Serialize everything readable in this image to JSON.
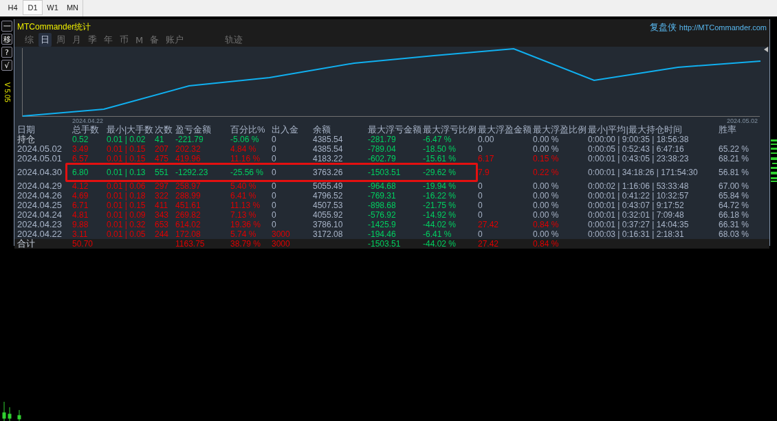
{
  "timeframes": [
    {
      "label": "H4",
      "selected": false
    },
    {
      "label": "D1",
      "selected": true
    },
    {
      "label": "W1",
      "selected": false
    },
    {
      "label": "MN",
      "selected": false
    }
  ],
  "toolbar": {
    "buttons": [
      "一",
      "移",
      "?",
      "√"
    ],
    "version": "V 5.05"
  },
  "panel": {
    "title": "MTCommander统计",
    "brand": "复盘侠",
    "link": "http://MTCommander.com",
    "tabs": [
      {
        "label": "综",
        "selected": false
      },
      {
        "label": "日",
        "selected": true
      },
      {
        "label": "周",
        "selected": false
      },
      {
        "label": "月",
        "selected": false
      },
      {
        "label": "季",
        "selected": false
      },
      {
        "label": "年",
        "selected": false
      },
      {
        "label": "币",
        "selected": false
      },
      {
        "label": "M",
        "selected": false
      },
      {
        "label": "备",
        "selected": false
      },
      {
        "label": "账户",
        "selected": false
      },
      {
        "label": "轨迹",
        "selected": false
      }
    ],
    "chart": {
      "start_label": "2024.04.22",
      "end_label": "2024.05.02"
    },
    "table": {
      "columns": [
        "日期",
        "总手数",
        "最小|大手数",
        "次数",
        "盈亏金额",
        "百分比%",
        "出入金",
        "余额",
        "最大浮亏金额",
        "最大浮亏比例",
        "最大浮盈金额",
        "最大浮盈比例",
        "最小|平均|最大持仓时间",
        "胜率"
      ],
      "rows": [
        {
          "highlighted": false,
          "cells": [
            {
              "text": "持仓",
              "color": "#c8d0dc"
            },
            {
              "text": "0.52",
              "color": "#00d060"
            },
            {
              "text": "0.01 | 0.02",
              "color": "#00d060"
            },
            {
              "text": "41",
              "color": "#00d060"
            },
            {
              "text": "-221.79",
              "color": "#00d060"
            },
            {
              "text": "-5.06 %",
              "color": "#00d060"
            },
            {
              "text": "0",
              "color": "#a8b4c8"
            },
            {
              "text": "4385.54",
              "color": "#a8b4c8"
            },
            {
              "text": "-281.79",
              "color": "#00d060"
            },
            {
              "text": "-6.47 %",
              "color": "#00d060"
            },
            {
              "text": "0.00",
              "color": "#a8b4c8"
            },
            {
              "text": "0.00 %",
              "color": "#a8b4c8"
            },
            {
              "text": "0:00:00 | 9:00:35 | 18:56:38",
              "color": "#a8b4c8"
            },
            null
          ]
        },
        {
          "highlighted": false,
          "cells": [
            {
              "text": "2024.05.02",
              "color": "#a8b4c8"
            },
            {
              "text": "3.49",
              "color": "#e00000"
            },
            {
              "text": "0.01 | 0.15",
              "color": "#e00000"
            },
            {
              "text": "207",
              "color": "#e00000"
            },
            {
              "text": "202.32",
              "color": "#e00000"
            },
            {
              "text": "4.84 %",
              "color": "#e00000"
            },
            {
              "text": "0",
              "color": "#a8b4c8"
            },
            {
              "text": "4385.54",
              "color": "#a8b4c8"
            },
            {
              "text": "-789.04",
              "color": "#00d060"
            },
            {
              "text": "-18.50 %",
              "color": "#00d060"
            },
            {
              "text": "0",
              "color": "#a8b4c8"
            },
            {
              "text": "0.00 %",
              "color": "#a8b4c8"
            },
            {
              "text": "0:00:05 | 0:52:43 | 6:47:16",
              "color": "#a8b4c8"
            },
            {
              "text": "65.22 %",
              "color": "#a8b4c8"
            }
          ]
        },
        {
          "highlighted": false,
          "cells": [
            {
              "text": "2024.05.01",
              "color": "#a8b4c8"
            },
            {
              "text": "6.57",
              "color": "#e00000"
            },
            {
              "text": "0.01 | 0.15",
              "color": "#e00000"
            },
            {
              "text": "475",
              "color": "#e00000"
            },
            {
              "text": "419.96",
              "color": "#e00000"
            },
            {
              "text": "11.16 %",
              "color": "#e00000"
            },
            {
              "text": "0",
              "color": "#a8b4c8"
            },
            {
              "text": "4183.22",
              "color": "#a8b4c8"
            },
            {
              "text": "-602.79",
              "color": "#00d060"
            },
            {
              "text": "-15.61 %",
              "color": "#00d060"
            },
            {
              "text": "6.17",
              "color": "#e00000"
            },
            {
              "text": "0.15 %",
              "color": "#e00000"
            },
            {
              "text": "0:00:01 | 0:43:05 | 23:38:23",
              "color": "#a8b4c8"
            },
            {
              "text": "68.21 %",
              "color": "#a8b4c8"
            }
          ]
        },
        {
          "highlighted": true,
          "cells": [
            {
              "text": "2024.04.30",
              "color": "#a8b4c8"
            },
            {
              "text": "6.80",
              "color": "#00d060"
            },
            {
              "text": "0.01 | 0.13",
              "color": "#00d060"
            },
            {
              "text": "551",
              "color": "#00d060"
            },
            {
              "text": "-1292.23",
              "color": "#00d060"
            },
            {
              "text": "-25.56 %",
              "color": "#00d060"
            },
            {
              "text": "0",
              "color": "#a8b4c8"
            },
            {
              "text": "3763.26",
              "color": "#a8b4c8"
            },
            {
              "text": "-1503.51",
              "color": "#00d060"
            },
            {
              "text": "-29.62 %",
              "color": "#00d060"
            },
            {
              "text": "7.9",
              "color": "#e00000"
            },
            {
              "text": "0.22 %",
              "color": "#e00000"
            },
            {
              "text": "0:00:01 | 34:18:26 | 171:54:30",
              "color": "#a8b4c8"
            },
            {
              "text": "56.81 %",
              "color": "#a8b4c8"
            }
          ]
        },
        {
          "highlighted": false,
          "cells": [
            {
              "text": "2024.04.29",
              "color": "#a8b4c8"
            },
            {
              "text": "4.12",
              "color": "#e00000"
            },
            {
              "text": "0.01 | 0.06",
              "color": "#e00000"
            },
            {
              "text": "297",
              "color": "#e00000"
            },
            {
              "text": "258.97",
              "color": "#e00000"
            },
            {
              "text": "5.40 %",
              "color": "#e00000"
            },
            {
              "text": "0",
              "color": "#a8b4c8"
            },
            {
              "text": "5055.49",
              "color": "#a8b4c8"
            },
            {
              "text": "-964.68",
              "color": "#00d060"
            },
            {
              "text": "-19.94 %",
              "color": "#00d060"
            },
            {
              "text": "0",
              "color": "#a8b4c8"
            },
            {
              "text": "0.00 %",
              "color": "#a8b4c8"
            },
            {
              "text": "0:00:02 | 1:16:06 | 53:33:48",
              "color": "#a8b4c8"
            },
            {
              "text": "67.00 %",
              "color": "#a8b4c8"
            }
          ]
        },
        {
          "highlighted": false,
          "cells": [
            {
              "text": "2024.04.26",
              "color": "#a8b4c8"
            },
            {
              "text": "4.69",
              "color": "#e00000"
            },
            {
              "text": "0.01 | 0.18",
              "color": "#e00000"
            },
            {
              "text": "322",
              "color": "#e00000"
            },
            {
              "text": "288.99",
              "color": "#e00000"
            },
            {
              "text": "6.41 %",
              "color": "#e00000"
            },
            {
              "text": "0",
              "color": "#a8b4c8"
            },
            {
              "text": "4796.52",
              "color": "#a8b4c8"
            },
            {
              "text": "-769.31",
              "color": "#00d060"
            },
            {
              "text": "-16.22 %",
              "color": "#00d060"
            },
            {
              "text": "0",
              "color": "#a8b4c8"
            },
            {
              "text": "0.00 %",
              "color": "#a8b4c8"
            },
            {
              "text": "0:00:01 | 0:41:22 | 10:32:57",
              "color": "#a8b4c8"
            },
            {
              "text": "65.84 %",
              "color": "#a8b4c8"
            }
          ]
        },
        {
          "highlighted": false,
          "cells": [
            {
              "text": "2024.04.25",
              "color": "#a8b4c8"
            },
            {
              "text": "6.71",
              "color": "#e00000"
            },
            {
              "text": "0.01 | 0.15",
              "color": "#e00000"
            },
            {
              "text": "411",
              "color": "#e00000"
            },
            {
              "text": "451.61",
              "color": "#e00000"
            },
            {
              "text": "11.13 %",
              "color": "#e00000"
            },
            {
              "text": "0",
              "color": "#a8b4c8"
            },
            {
              "text": "4507.53",
              "color": "#a8b4c8"
            },
            {
              "text": "-898.68",
              "color": "#00d060"
            },
            {
              "text": "-21.75 %",
              "color": "#00d060"
            },
            {
              "text": "0",
              "color": "#a8b4c8"
            },
            {
              "text": "0.00 %",
              "color": "#a8b4c8"
            },
            {
              "text": "0:00:01 | 0:43:07 | 9:17:52",
              "color": "#a8b4c8"
            },
            {
              "text": "64.72 %",
              "color": "#a8b4c8"
            }
          ]
        },
        {
          "highlighted": false,
          "cells": [
            {
              "text": "2024.04.24",
              "color": "#a8b4c8"
            },
            {
              "text": "4.81",
              "color": "#e00000"
            },
            {
              "text": "0.01 | 0.09",
              "color": "#e00000"
            },
            {
              "text": "343",
              "color": "#e00000"
            },
            {
              "text": "269.82",
              "color": "#e00000"
            },
            {
              "text": "7.13 %",
              "color": "#e00000"
            },
            {
              "text": "0",
              "color": "#a8b4c8"
            },
            {
              "text": "4055.92",
              "color": "#a8b4c8"
            },
            {
              "text": "-576.92",
              "color": "#00d060"
            },
            {
              "text": "-14.92 %",
              "color": "#00d060"
            },
            {
              "text": "0",
              "color": "#a8b4c8"
            },
            {
              "text": "0.00 %",
              "color": "#a8b4c8"
            },
            {
              "text": "0:00:01 | 0:32:01 | 7:09:48",
              "color": "#a8b4c8"
            },
            {
              "text": "66.18 %",
              "color": "#a8b4c8"
            }
          ]
        },
        {
          "highlighted": false,
          "cells": [
            {
              "text": "2024.04.23",
              "color": "#a8b4c8"
            },
            {
              "text": "9.88",
              "color": "#e00000"
            },
            {
              "text": "0.01 | 0.32",
              "color": "#e00000"
            },
            {
              "text": "653",
              "color": "#e00000"
            },
            {
              "text": "614.02",
              "color": "#e00000"
            },
            {
              "text": "19.36 %",
              "color": "#e00000"
            },
            {
              "text": "0",
              "color": "#a8b4c8"
            },
            {
              "text": "3786.10",
              "color": "#a8b4c8"
            },
            {
              "text": "-1425.9",
              "color": "#00d060"
            },
            {
              "text": "-44.02 %",
              "color": "#00d060"
            },
            {
              "text": "27.42",
              "color": "#e00000"
            },
            {
              "text": "0.84 %",
              "color": "#e00000"
            },
            {
              "text": "0:00:01 | 0:37:27 | 14:04:35",
              "color": "#a8b4c8"
            },
            {
              "text": "66.31 %",
              "color": "#a8b4c8"
            }
          ]
        },
        {
          "highlighted": false,
          "cells": [
            {
              "text": "2024.04.22",
              "color": "#a8b4c8"
            },
            {
              "text": "3.11",
              "color": "#e00000"
            },
            {
              "text": "0.01 | 0.05",
              "color": "#e00000"
            },
            {
              "text": "244",
              "color": "#e00000"
            },
            {
              "text": "172.08",
              "color": "#e00000"
            },
            {
              "text": "5.74 %",
              "color": "#e00000"
            },
            {
              "text": "3000",
              "color": "#e00000"
            },
            {
              "text": "3172.08",
              "color": "#a8b4c8"
            },
            {
              "text": "-194.46",
              "color": "#00d060"
            },
            {
              "text": "-6.41 %",
              "color": "#00d060"
            },
            {
              "text": "0",
              "color": "#a8b4c8"
            },
            {
              "text": "0.00 %",
              "color": "#a8b4c8"
            },
            {
              "text": "0:00:03 | 0:16:31 | 2:18:31",
              "color": "#a8b4c8"
            },
            {
              "text": "68.03 %",
              "color": "#a8b4c8"
            }
          ]
        }
      ],
      "total": {
        "label": {
          "text": "合计",
          "color": "#c8d0dc"
        },
        "lots": {
          "text": "50.70",
          "color": "#e00000"
        },
        "profit": {
          "text": "1163.75",
          "color": "#e00000"
        },
        "percent": {
          "text": "38.79 %",
          "color": "#e00000"
        },
        "deposit": {
          "text": "3000",
          "color": "#e00000"
        },
        "max_float_loss": {
          "text": "-1503.51",
          "color": "#00d060"
        },
        "max_float_loss_ratio": {
          "text": "-44.02 %",
          "color": "#00d060"
        },
        "max_float_profit": {
          "text": "27.42",
          "color": "#e00000"
        },
        "max_float_profit_ratio": {
          "text": "0.84 %",
          "color": "#e00000"
        }
      }
    }
  }
}
